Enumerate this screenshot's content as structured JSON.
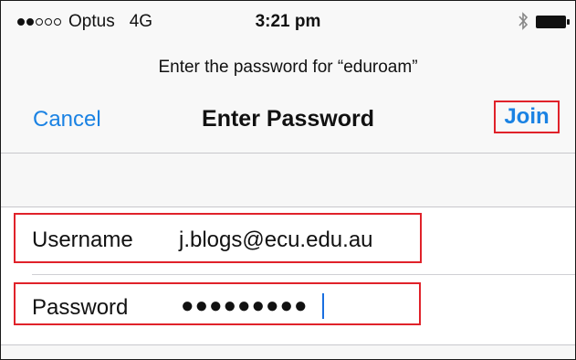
{
  "status_bar": {
    "signal_dots": [
      true,
      true,
      false,
      false,
      false
    ],
    "carrier": "Optus",
    "network": "4G",
    "time": "3:21 pm",
    "bluetooth_icon": "bluetooth-icon",
    "battery_icon": "battery-icon"
  },
  "prompt": "Enter the password for “eduroam”",
  "nav": {
    "cancel_label": "Cancel",
    "title": "Enter Password",
    "join_label": "Join"
  },
  "form": {
    "username_label": "Username",
    "username_value": "j.blogs@ecu.edu.au",
    "password_label": "Password",
    "password_masked": "●●●●●●●●●"
  },
  "colors": {
    "accent": "#1a82e3",
    "highlight": "#e0222a"
  }
}
